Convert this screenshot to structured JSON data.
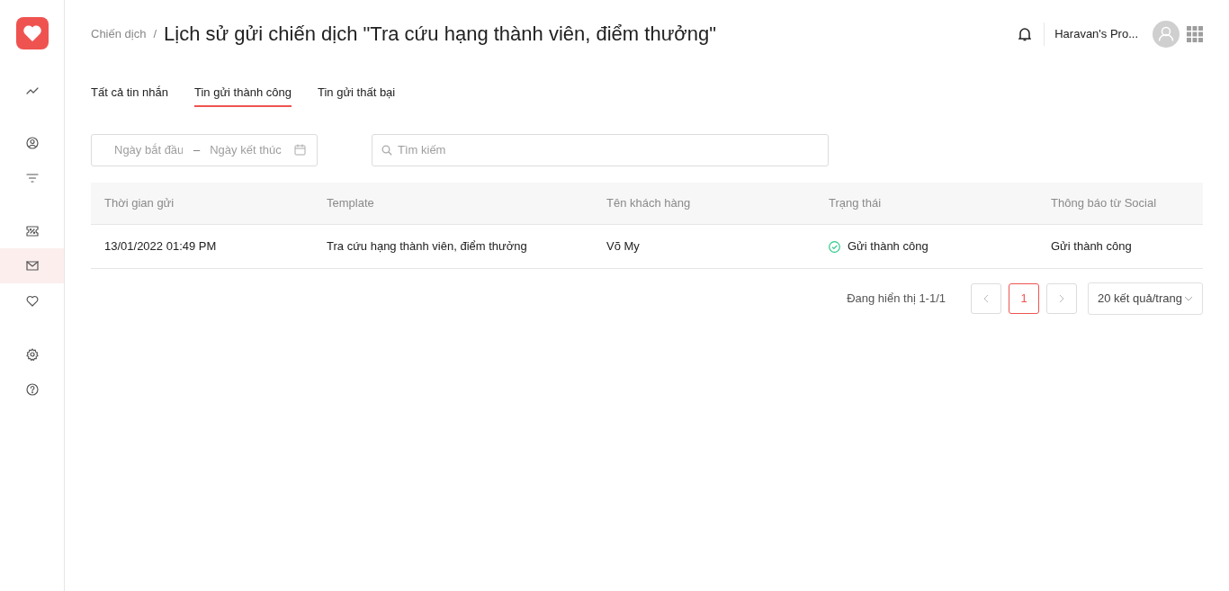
{
  "sidebar": {
    "groups": [
      {
        "items": [
          {
            "kind": "trend",
            "selected": false
          }
        ]
      },
      {
        "items": [
          {
            "kind": "user",
            "selected": false
          },
          {
            "kind": "filter",
            "selected": false
          }
        ]
      },
      {
        "items": [
          {
            "kind": "coupon",
            "selected": false
          },
          {
            "kind": "mail",
            "selected": true
          },
          {
            "kind": "heart",
            "selected": false
          }
        ]
      },
      {
        "items": [
          {
            "kind": "gear",
            "selected": false
          },
          {
            "kind": "help",
            "selected": false
          }
        ]
      }
    ]
  },
  "header": {
    "breadcrumb": "Chiến dịch",
    "separator": "/",
    "title": "Lịch sử gửi chiến dịch \"Tra cứu hạng thành viên, điểm thưởng\"",
    "store_name": "Haravan's Pro..."
  },
  "tabs": [
    {
      "label": "Tất cả tin nhắn",
      "selected": false
    },
    {
      "label": "Tin gửi thành công",
      "selected": true
    },
    {
      "label": "Tin gửi thất bại",
      "selected": false
    }
  ],
  "date_range": {
    "start_placeholder": "Ngày bắt đầu",
    "separator": "–",
    "end_placeholder": "Ngày kết thúc"
  },
  "search": {
    "placeholder": "Tìm kiếm"
  },
  "table": {
    "columns": [
      "Thời gian gửi",
      "Template",
      "Tên khách hàng",
      "Trạng thái",
      "Thông báo từ Social"
    ],
    "rows": [
      {
        "sent_time": "13/01/2022 01:49 PM",
        "template": "Tra cứu hạng thành viên, điểm thưởng",
        "customer": "Võ My",
        "status": "Gửi thành công",
        "status_ok": true,
        "social_message": "Gửi thành công"
      }
    ]
  },
  "pagination": {
    "summary": "Đang hiển thị 1-1/1",
    "pages": [
      {
        "label": "1",
        "selected": true
      }
    ],
    "page_size": "20 kết quả/trang"
  }
}
